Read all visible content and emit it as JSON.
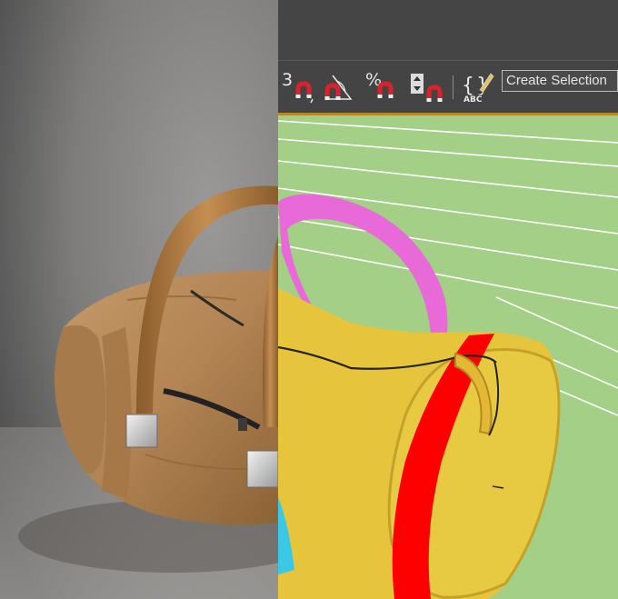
{
  "toolbar": {
    "snap_3d_label": "3",
    "percent_snap_label": "%",
    "edit_named_selection_label": "ABC",
    "named_selection_field": "Create Selection"
  },
  "colors": {
    "viewport_bg": "#a4cf86",
    "toolbar_bg": "#444444",
    "magnet_red": "#d9232a",
    "bag_tan": "#b88a5c",
    "bag_yellow": "#e6c43c",
    "stripe_red": "#ff0000",
    "handle_pink": "#e86ad8",
    "accent_cyan": "#3ac8e4"
  },
  "icons": [
    "snap-3d-icon",
    "angle-snap-icon",
    "percent-snap-icon",
    "spinner-snap-icon",
    "edit-named-selections-icon"
  ]
}
